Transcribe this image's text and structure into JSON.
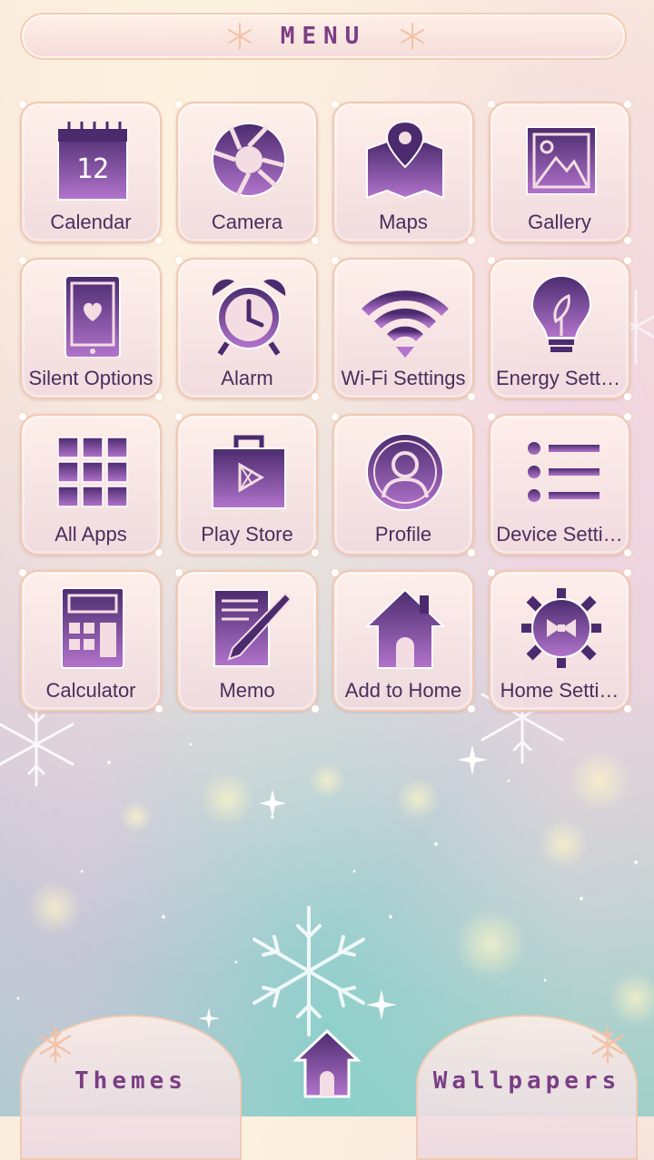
{
  "menu": {
    "title": "MENU"
  },
  "apps": [
    {
      "label": "Calendar",
      "icon": "calendar-icon",
      "calendar_day": "12"
    },
    {
      "label": "Camera",
      "icon": "camera-shutter-icon"
    },
    {
      "label": "Maps",
      "icon": "map-pin-icon"
    },
    {
      "label": "Gallery",
      "icon": "gallery-image-icon"
    },
    {
      "label": "Silent Options",
      "icon": "phone-heart-icon"
    },
    {
      "label": "Alarm",
      "icon": "alarm-clock-icon"
    },
    {
      "label": "Wi-Fi Settings",
      "icon": "wifi-icon"
    },
    {
      "label": "Energy Setti…",
      "icon": "lightbulb-icon"
    },
    {
      "label": "All Apps",
      "icon": "grid-icon"
    },
    {
      "label": "Play Store",
      "icon": "play-store-bag-icon"
    },
    {
      "label": "Profile",
      "icon": "profile-avatar-icon"
    },
    {
      "label": "Device Setti…",
      "icon": "list-icon"
    },
    {
      "label": "Calculator",
      "icon": "calculator-icon"
    },
    {
      "label": "Memo",
      "icon": "memo-pencil-icon"
    },
    {
      "label": "Add to Home",
      "icon": "house-icon"
    },
    {
      "label": "Home Setti…",
      "icon": "gear-bow-icon"
    }
  ],
  "bottom": {
    "themes_label": "Themes",
    "wallpapers_label": "Wallpapers"
  },
  "colors": {
    "accent": "#7a3e84",
    "icon_dark": "#4b2b6e",
    "icon_light": "#b070c8",
    "tile_border": "#f0c9b2"
  }
}
